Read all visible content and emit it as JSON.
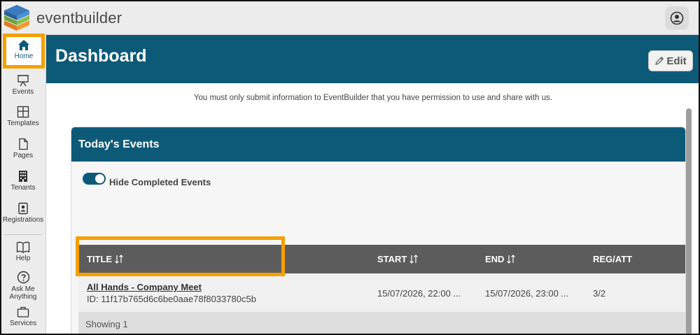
{
  "app": {
    "brand": "eventbuilder"
  },
  "sidebar": {
    "items": [
      {
        "label": "Home",
        "icon": "home-icon",
        "active": true
      },
      {
        "label": "Events",
        "icon": "presentation-icon"
      },
      {
        "label": "Templates",
        "icon": "layout-icon"
      },
      {
        "label": "Pages",
        "icon": "page-icon"
      },
      {
        "label": "Tenants",
        "icon": "building-icon"
      },
      {
        "label": "Registrations",
        "icon": "badge-icon"
      },
      {
        "label": "Help",
        "icon": "book-icon"
      },
      {
        "label": "Ask Me Anything",
        "icon": "question-icon"
      },
      {
        "label": "Services",
        "icon": "briefcase-icon"
      }
    ]
  },
  "header": {
    "title": "Dashboard",
    "edit_label": "Edit"
  },
  "notice": "You must only submit information to EventBuilder that you have permission to use and share with us.",
  "card": {
    "title": "Today's Events",
    "toggle": {
      "label": "Hide Completed Events",
      "on": true
    },
    "columns": [
      "TITLE",
      "START",
      "END",
      "REG/ATT"
    ],
    "rows": [
      {
        "title": "All Hands - Company Meet",
        "id": "ID: 11f17b765d6c6be0aae78f8033780c5b",
        "start": "15/07/2026, 22:00 ...",
        "end": "15/07/2026, 23:00 ...",
        "reg_att": "3/2"
      }
    ],
    "footer": "Showing 1"
  },
  "colors": {
    "primary": "#0d5a78",
    "highlight": "#f5a000",
    "table_header": "#5c5c5c"
  }
}
